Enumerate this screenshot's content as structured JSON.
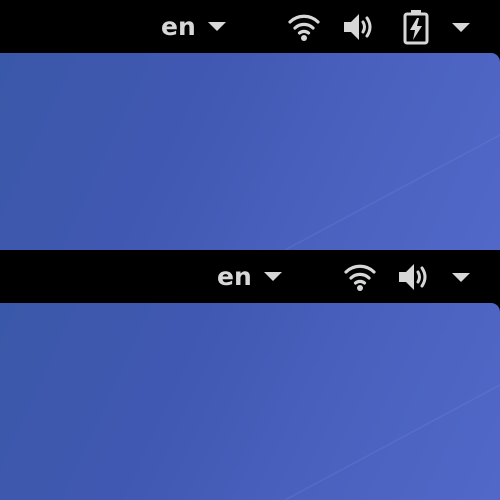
{
  "panels": [
    {
      "topbar": {
        "language": "en",
        "indicators": [
          "wifi-icon",
          "volume-icon",
          "battery-charging-icon",
          "system-menu-caret"
        ]
      }
    },
    {
      "topbar": {
        "language": "en",
        "indicators": [
          "wifi-icon",
          "volume-icon",
          "system-menu-caret"
        ]
      }
    }
  ],
  "colors": {
    "topbar": "#000000",
    "icon": "#d7d7d7",
    "wallpaper_start": "#3a58a8",
    "wallpaper_end": "#5168c9"
  }
}
